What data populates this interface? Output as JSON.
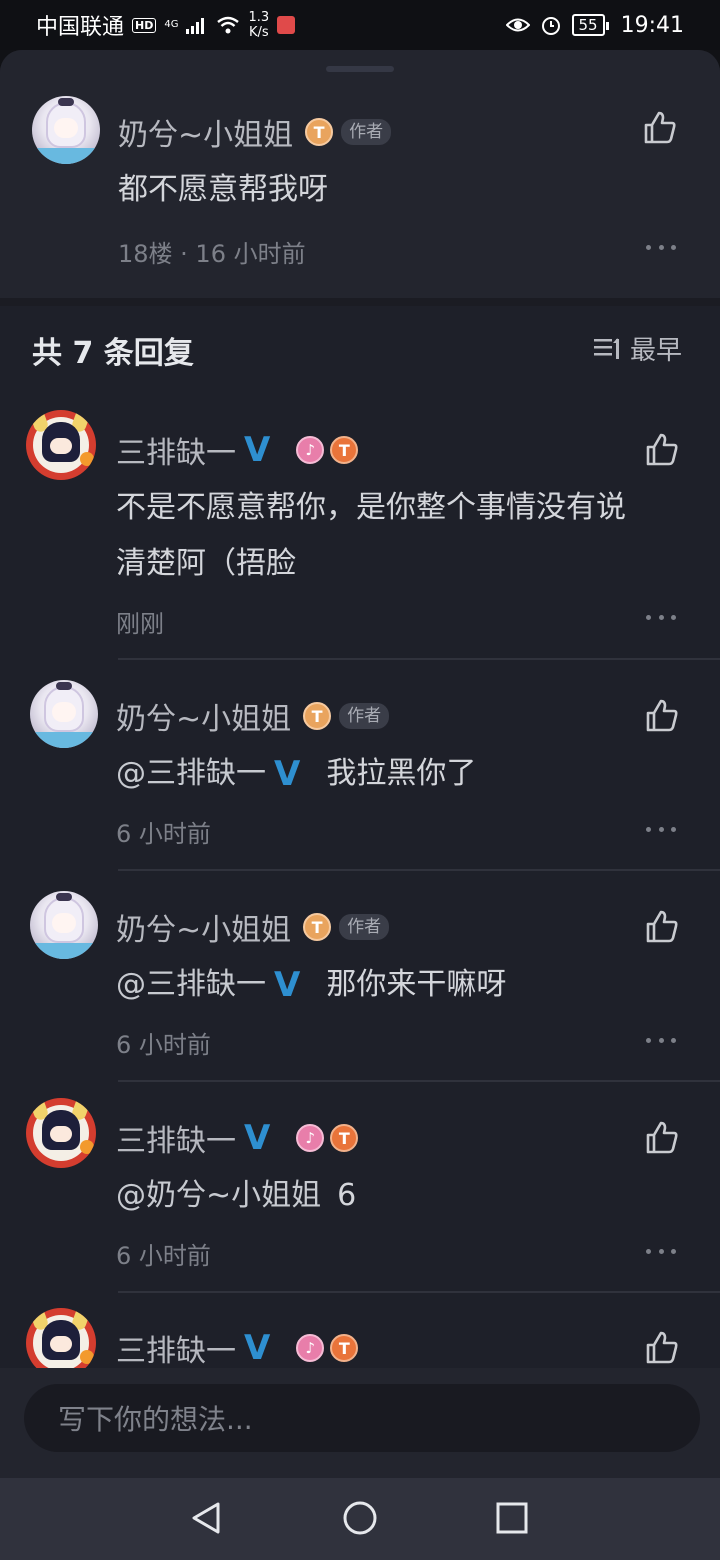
{
  "status_bar": {
    "carrier": "中国联通",
    "hd": "HD",
    "net": "4G",
    "speed": "1.3",
    "speed_unit": "K/s",
    "battery": "55",
    "time": "19:41"
  },
  "top_comment": {
    "user": "奶兮~小姐姐",
    "badge": "T",
    "tag": "作者",
    "text": "都不愿意帮我呀",
    "meta": "18楼 · 16 小时前"
  },
  "replies_header": {
    "count_label": "共 7 条回复",
    "sort_label": "最早"
  },
  "replies": [
    {
      "user": "三排缺一",
      "verified": "V",
      "text_line1": "不是不愿意帮你，是你整个事情没有说",
      "text_line2": "清楚阿（捂脸",
      "meta": "刚刚"
    },
    {
      "user": "奶兮~小姐姐",
      "tag": "作者",
      "mention": "@三排缺一",
      "verified": "V",
      "text": "我拉黑你了",
      "meta": "6 小时前"
    },
    {
      "user": "奶兮~小姐姐",
      "tag": "作者",
      "mention": "@三排缺一",
      "verified": "V",
      "text": "那你来干嘛呀",
      "meta": "6 小时前"
    },
    {
      "user": "三排缺一",
      "verified": "V",
      "mention": "@奶兮~小姐姐",
      "text": "6",
      "meta": "6 小时前"
    },
    {
      "user": "三排缺一",
      "verified": "V"
    }
  ],
  "input": {
    "placeholder": "写下你的想法..."
  }
}
